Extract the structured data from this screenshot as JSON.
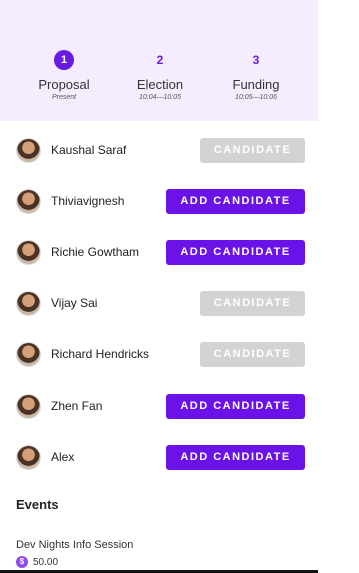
{
  "phases": [
    {
      "number": "1",
      "title": "Proposal",
      "subtitle": "Present",
      "active": true
    },
    {
      "number": "2",
      "title": "Election",
      "subtitle": "10:04—10:05",
      "active": false
    },
    {
      "number": "3",
      "title": "Funding",
      "subtitle": "10:05—10:06",
      "active": false
    }
  ],
  "candidates": [
    {
      "name": "Kaushal Saraf",
      "button": "CANDIDATE"
    },
    {
      "name": "Thiviavignesh",
      "button": "ADD CANDIDATE"
    },
    {
      "name": "Richie Gowtham",
      "button": "ADD CANDIDATE"
    },
    {
      "name": "Vijay Sai",
      "button": "CANDIDATE"
    },
    {
      "name": "Richard Hendricks",
      "button": "CANDIDATE"
    },
    {
      "name": "Zhen Fan",
      "button": "ADD CANDIDATE"
    },
    {
      "name": "Alex",
      "button": "ADD CANDIDATE"
    }
  ],
  "events": {
    "heading": "Events",
    "items": [
      {
        "title": "Dev Nights Info Session",
        "price": "50.00",
        "currency_icon": "dollar-coin-icon"
      }
    ]
  },
  "colors": {
    "accent": "#6a12e8",
    "header_bg": "#f6ecff",
    "disabled_button": "#d3d3d3"
  }
}
